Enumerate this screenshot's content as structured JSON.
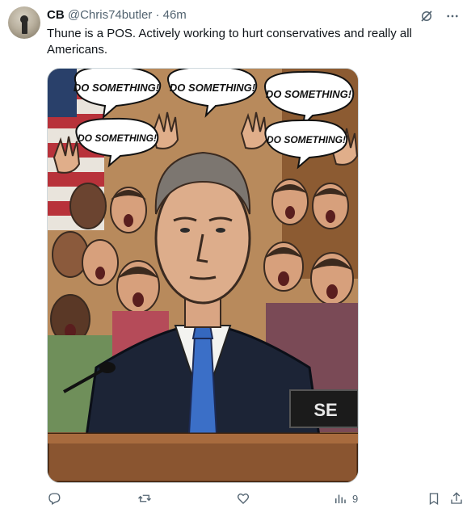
{
  "tweet": {
    "display_name": "CB",
    "handle": "@Chris74butler",
    "separator": "·",
    "time": "46m",
    "text": "Thune is a POS. Actively working to hurt conservatives and really all Americans.",
    "media": {
      "bubbles": [
        "DO SOMETHING!",
        "DO SOMETHING!",
        "DO SOMETHING!",
        "DO SOMETHING!",
        "DO SOMETHING!"
      ],
      "nameplate": "SE"
    },
    "actions": {
      "views_count": "9"
    },
    "icons": {
      "grok": "grok-icon",
      "more": "more-icon",
      "reply": "reply-icon",
      "retweet": "retweet-icon",
      "like": "like-icon",
      "views": "views-icon",
      "bookmark": "bookmark-icon",
      "share": "share-icon"
    },
    "colors": {
      "text": "#0f1419",
      "secondary": "#536471",
      "border": "#cfd9de"
    }
  }
}
